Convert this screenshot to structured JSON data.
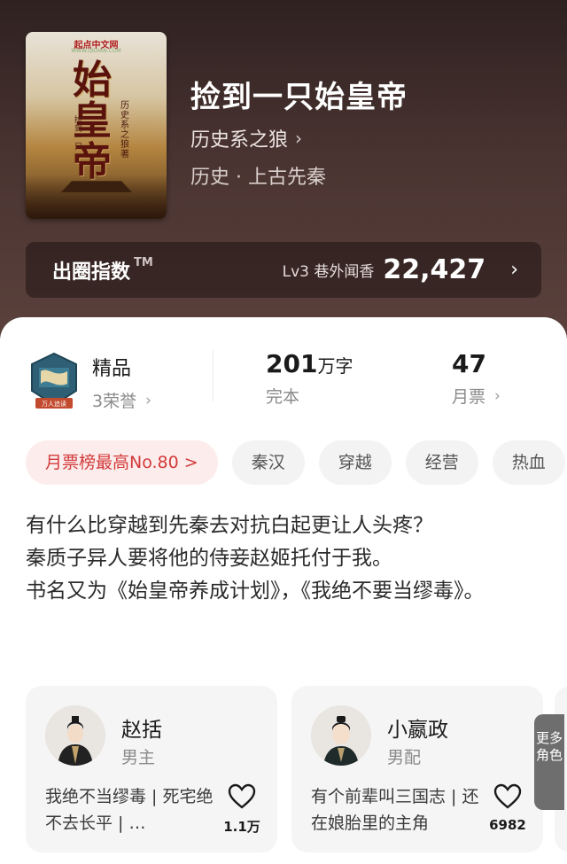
{
  "book": {
    "title": "捡到一只始皇帝",
    "author": "历史系之狼",
    "category": "历史 · 上古先秦",
    "cover": {
      "publisher": "起点中文网",
      "big_title": "始皇帝",
      "vertical_1": "历史系之狼著",
      "vertical_2": "捡到一只"
    }
  },
  "influence": {
    "label": "出圈指数",
    "trademark": "TM",
    "level": "Lv3 巷外闻香",
    "value": "22,427"
  },
  "stats": {
    "quality_main": "精品",
    "quality_sub": "3荣誉",
    "badge_text": "万人追读",
    "words_num": "201",
    "words_unit": "万字",
    "words_sub": "完本",
    "votes_num": "47",
    "votes_sub": "月票"
  },
  "tags": [
    "月票榜最高No.80 >",
    "秦汉",
    "穿越",
    "经营",
    "热血"
  ],
  "description": [
    "有什么比穿越到先秦去对抗白起更让人头疼？",
    "秦质子异人要将他的侍妾赵姬托付于我。",
    "书名又为《始皇帝养成计划》，《我绝不要当缪毒》。"
  ],
  "characters": [
    {
      "name": "赵括",
      "role": "男主",
      "quote": "我绝不当缪毒 | 死宅绝不去长平 | …",
      "likes": "1.1万"
    },
    {
      "name": "小嬴政",
      "role": "男配",
      "quote": "有个前辈叫三国志 | 还在娘胎里的主角",
      "likes": "6982"
    }
  ],
  "more_roles": "更多角色",
  "colors": {
    "accent_red": "#d23a3a",
    "hero_bg": "#4a3431"
  }
}
